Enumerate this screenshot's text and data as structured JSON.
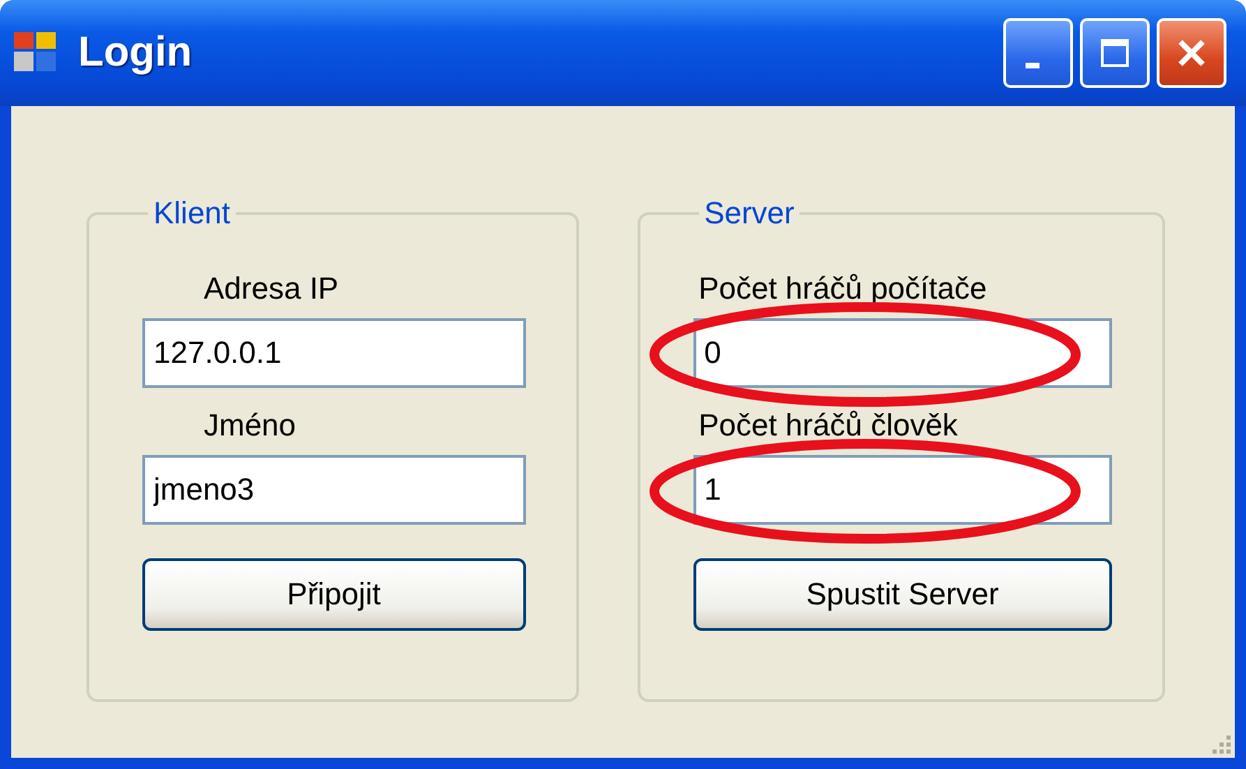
{
  "window": {
    "title": "Login"
  },
  "groups": [
    {
      "title": "Klient",
      "fields": [
        {
          "label": "Adresa IP",
          "value": "127.0.0.1",
          "highlighted": false
        },
        {
          "label": "Jméno",
          "value": "jmeno3",
          "highlighted": false
        }
      ],
      "button": "Připojit"
    },
    {
      "title": "Server",
      "fields": [
        {
          "label": "Počet hráčů počítače",
          "value": "0",
          "highlighted": true
        },
        {
          "label": "Počet hráčů člověk",
          "value": "1",
          "highlighted": true
        }
      ],
      "button": "Spustit Server"
    }
  ]
}
